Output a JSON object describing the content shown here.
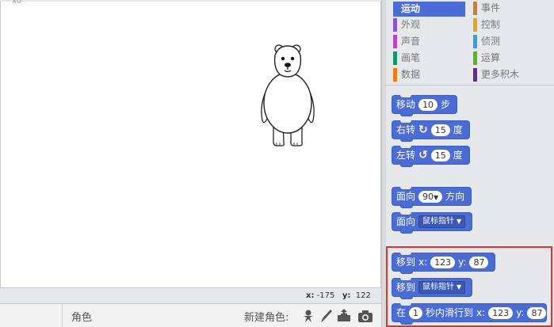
{
  "stage": {
    "top_text": "x0"
  },
  "coords": {
    "x_label": "x:",
    "x_value": "-175",
    "y_label": "y:",
    "y_value": "122"
  },
  "sprite_bar": {
    "sprite_label": "角色",
    "new_sprite_label": "新建角色:",
    "icons": [
      "sprite-library-icon",
      "paint-brush-icon",
      "upload-icon",
      "camera-icon"
    ]
  },
  "categories": [
    {
      "label": "运动",
      "color": "#4a6cd4",
      "active": true
    },
    {
      "label": "事件",
      "color": "#c88330"
    },
    {
      "label": "外观",
      "color": "#8a55d7"
    },
    {
      "label": "控制",
      "color": "#e1a91a"
    },
    {
      "label": "声音",
      "color": "#bb42c3"
    },
    {
      "label": "侦测",
      "color": "#2ca5e2"
    },
    {
      "label": "画笔",
      "color": "#0e9a6c"
    },
    {
      "label": "运算",
      "color": "#5cb712"
    },
    {
      "label": "数据",
      "color": "#ee7d16"
    },
    {
      "label": "更多积木",
      "color": "#632d99"
    }
  ],
  "blocks": {
    "move": {
      "text": "移动",
      "steps": "10",
      "suffix": "步"
    },
    "turn_right": {
      "text": "右转",
      "degrees": "15",
      "suffix": "度"
    },
    "turn_left": {
      "text": "左转",
      "degrees": "15",
      "suffix": "度"
    },
    "point_direction": {
      "text": "面向",
      "value": "90",
      "suffix": "方向"
    },
    "point_towards": {
      "text": "面向",
      "value": "鼠标指针"
    },
    "go_to_xy": {
      "text": "移到",
      "x_label": "x:",
      "x": "123",
      "y_label": "y:",
      "y": "87"
    },
    "go_to": {
      "text": "移到",
      "value": "鼠标指针"
    },
    "glide": {
      "text": "在",
      "secs": "1",
      "mid": "秒内滑行到",
      "x_label": "x:",
      "x": "123",
      "y_label": "y:",
      "y": "87"
    }
  }
}
